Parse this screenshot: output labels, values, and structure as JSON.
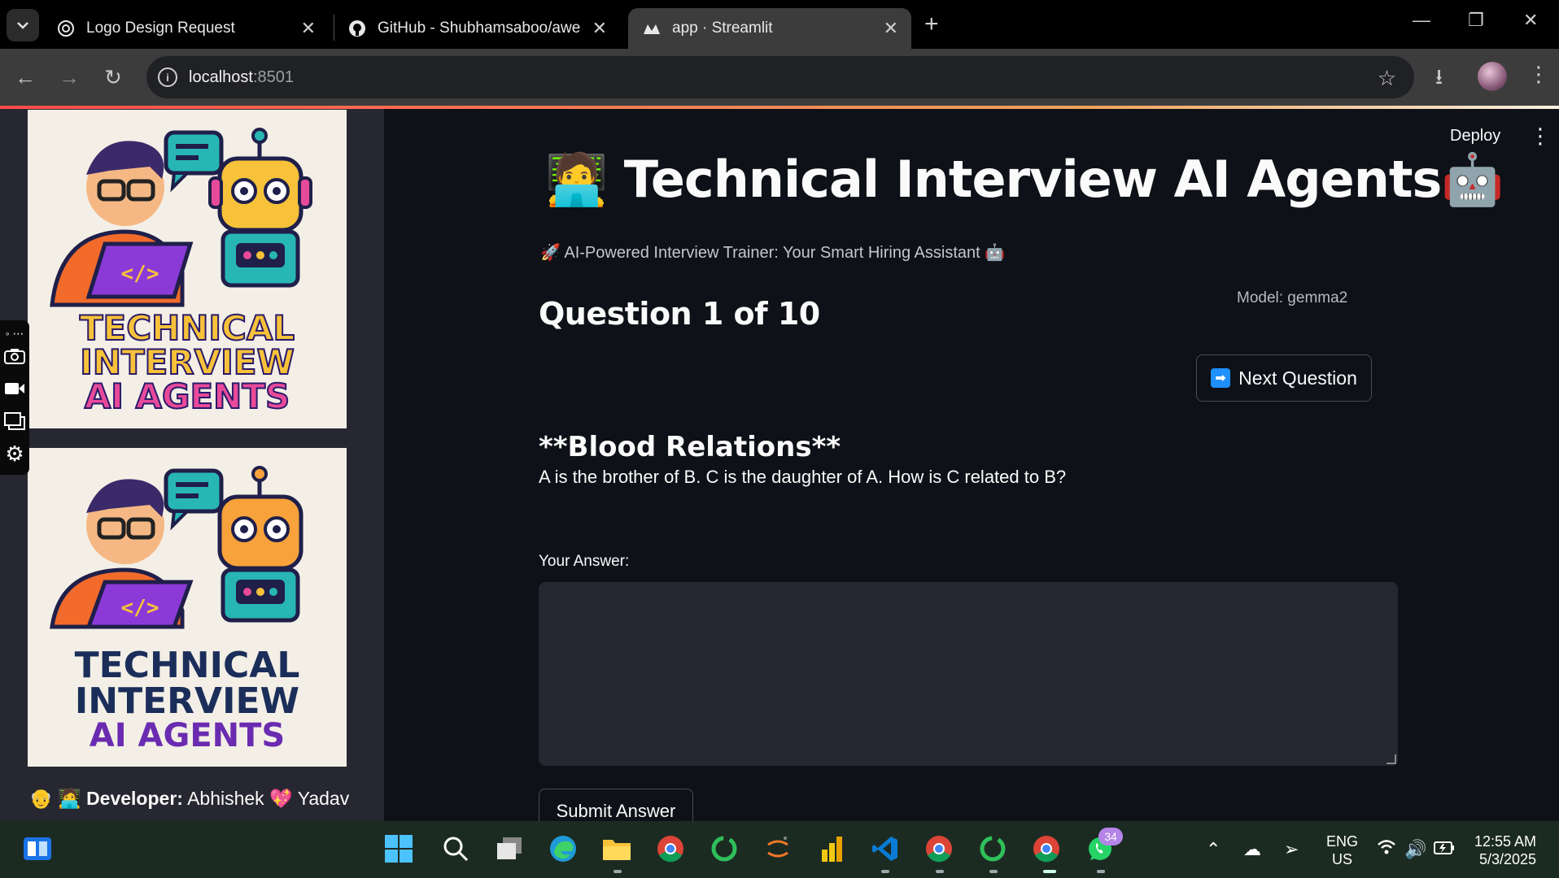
{
  "browser": {
    "tabs": [
      {
        "title": "Logo Design Request",
        "icon": "openai-icon",
        "active": false
      },
      {
        "title": "GitHub - Shubhamsaboo/awesome",
        "icon": "github-icon",
        "active": false
      },
      {
        "title": "app · Streamlit",
        "icon": "streamlit-icon",
        "active": true
      }
    ],
    "address": {
      "host": "localhost",
      "port": ":8501"
    }
  },
  "sidebar": {
    "logo_text": {
      "line1": "TECHNICAL",
      "line2": "INTERVIEW",
      "line3": "AI AGENTS"
    },
    "developer_label": "Developer:",
    "developer_name_first": "Abhishek",
    "developer_name_last": "Yadav",
    "emoji_prefix": "👴 🧑‍💻",
    "heart": "💖"
  },
  "header": {
    "deploy_label": "Deploy",
    "menu_icon": "kebab-menu-icon"
  },
  "main": {
    "title": "Technical Interview AI Agents",
    "title_emoji_left": "🧑‍💻",
    "title_emoji_right": "🤖",
    "subtitle": "AI-Powered Interview Trainer: Your Smart Hiring Assistant",
    "subtitle_emoji_left": "🚀",
    "subtitle_emoji_right": "🤖",
    "question_heading": "Question 1 of 10",
    "model_label": "Model: gemma2",
    "next_button": "Next Question",
    "question_topic": "**Blood Relations**",
    "question_text": "A is the brother of B. C is the daughter of A. How is C related to B?",
    "answer_label": "Your Answer:",
    "answer_value": "",
    "submit_button": "Submit Answer"
  },
  "taskbar": {
    "whatsapp_badge": "34",
    "language": "ENG",
    "region": "US",
    "time": "12:55 AM",
    "date": "5/3/2025"
  }
}
